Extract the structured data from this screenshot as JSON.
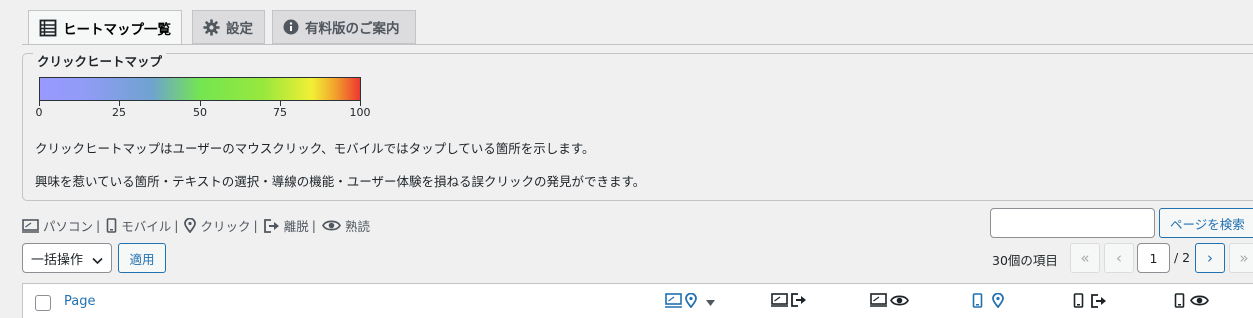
{
  "tabs": [
    {
      "label": "ヒートマップ一覧",
      "icon": "list-icon",
      "active": true
    },
    {
      "label": "設定",
      "icon": "gear-icon",
      "active": false
    },
    {
      "label": "有料版のご案内",
      "icon": "info-icon",
      "active": false
    }
  ],
  "legend": {
    "title": "クリックヒートマップ",
    "scale": [
      "0",
      "25",
      "50",
      "75",
      "100"
    ],
    "description1": "クリックヒートマップはユーザーのマウスクリック、モバイルではタップしている箇所を示します。",
    "description2": "興味を惹いている箇所・テキストの選択・導線の機能・ユーザー体験を損ねる誤クリックの発見ができます。"
  },
  "filters": [
    {
      "label": "パソコン",
      "icon": "desktop-icon"
    },
    {
      "label": "モバイル",
      "icon": "mobile-icon"
    },
    {
      "label": "クリック",
      "icon": "location-pin-icon"
    },
    {
      "label": "離脱",
      "icon": "exit-icon"
    },
    {
      "label": "熟読",
      "icon": "eye-icon"
    }
  ],
  "filter_separator": "|",
  "search": {
    "placeholder": "",
    "button_label": "ページを検索"
  },
  "bulk_actions": {
    "selected": "一括操作",
    "apply_label": "適用"
  },
  "pagination": {
    "item_count": "30個の項目",
    "first": "«",
    "prev": "‹",
    "current_page": "1",
    "total": "/ 2",
    "next": "›",
    "last": "»"
  },
  "table": {
    "column_page": "Page"
  },
  "colors": {
    "accent": "#2271b1",
    "border": "#c3c4c7",
    "background": "#f0f0f1"
  }
}
